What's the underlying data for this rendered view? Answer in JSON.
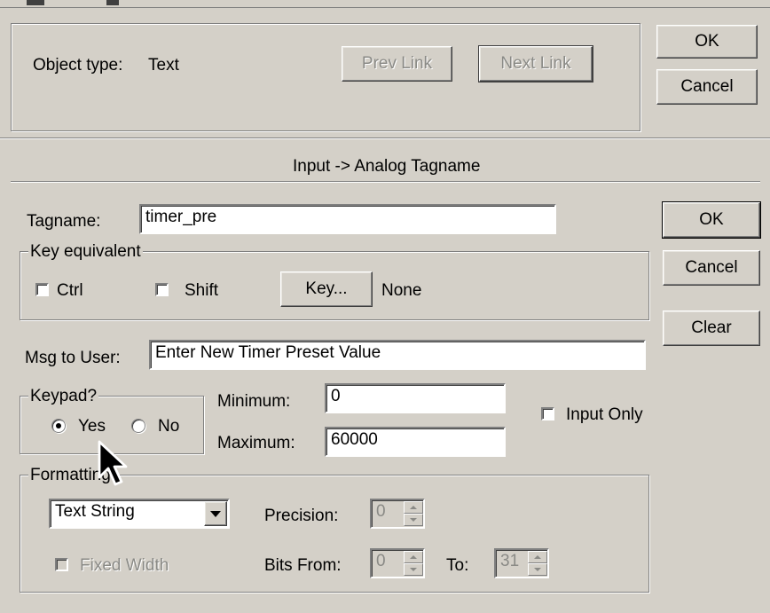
{
  "top": {
    "object_type_label": "Object type:",
    "object_type_value": "Text",
    "prev_link": "Prev Link",
    "next_link": "Next Link",
    "ok": "OK",
    "cancel": "Cancel"
  },
  "section_title": "Input -> Analog Tagname",
  "tagname": {
    "label": "Tagname:",
    "value": "timer_pre"
  },
  "key_equivalent": {
    "legend": "Key equivalent",
    "ctrl": "Ctrl",
    "ctrl_checked": false,
    "shift": "Shift",
    "shift_checked": false,
    "key_button": "Key...",
    "key_value": "None"
  },
  "buttons": {
    "ok": "OK",
    "cancel": "Cancel",
    "clear": "Clear"
  },
  "msg_to_user": {
    "label": "Msg to User:",
    "value": "Enter New Timer Preset Value"
  },
  "keypad": {
    "legend": "Keypad?",
    "yes": "Yes",
    "no": "No",
    "selected": "Yes"
  },
  "minimum": {
    "label": "Minimum:",
    "value": "0"
  },
  "maximum": {
    "label": "Maximum:",
    "value": "60000"
  },
  "input_only": {
    "label": "Input Only",
    "checked": false
  },
  "formatting": {
    "legend": "Formatting",
    "format_selected": "Text String",
    "precision_label": "Precision:",
    "precision_value": "0",
    "fixed_width_label": "Fixed Width",
    "bits_from_label": "Bits From:",
    "bits_from_value": "0",
    "to_label": "To:",
    "to_value": "31"
  }
}
